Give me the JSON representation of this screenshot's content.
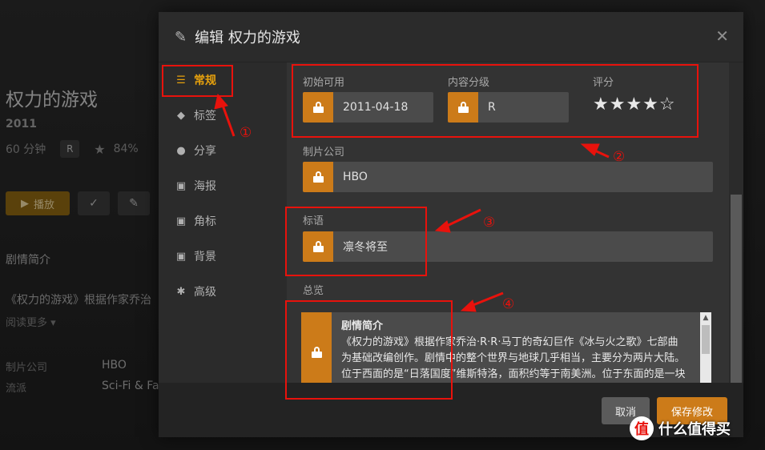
{
  "background": {
    "title": "权力的游戏",
    "year": "2011",
    "duration": "60 分钟",
    "rating_badge": "R",
    "score": "84%",
    "play_label": "播放",
    "summary_heading": "剧情简介",
    "summary_text": "《权力的游戏》根据作家乔治",
    "read_more": "阅读更多 ▾",
    "studio_label": "制片公司",
    "studio_value": "HBO",
    "genre_label": "流派",
    "genre_value": "Sci-Fi & Fa"
  },
  "modal": {
    "title": "编辑 权力的游戏",
    "sidebar": [
      {
        "label": "常规",
        "icon": "list-icon",
        "active": true
      },
      {
        "label": "标签",
        "icon": "tag-icon",
        "active": false
      },
      {
        "label": "分享",
        "icon": "users-icon",
        "active": false
      },
      {
        "label": "海报",
        "icon": "image-icon",
        "active": false
      },
      {
        "label": "角标",
        "icon": "image-icon",
        "active": false
      },
      {
        "label": "背景",
        "icon": "image-icon",
        "active": false
      },
      {
        "label": "高级",
        "icon": "gear-icon",
        "active": false
      }
    ],
    "fields": {
      "originally_available_label": "初始可用",
      "originally_available_value": "2011-04-18",
      "content_rating_label": "内容分级",
      "content_rating_value": "R",
      "rating_label": "评分",
      "rating_stars": "★★★★☆",
      "studio_label": "制片公司",
      "studio_value": "HBO",
      "tagline_label": "标语",
      "tagline_value": "凛冬将至",
      "summary_label": "总览",
      "summary_heading": "剧情简介",
      "summary_text": "《权力的游戏》根据作家乔治·R·R·马丁的奇幻巨作《冰与火之歌》七部曲为基础改编创作。剧情中的整个世界与地球几乎相当，主要分为两片大陆。位于西面的是“日落国度”维斯特洛，面积约等于南美洲。位于东面的是一块面积、形状近似于亚欧大陆的陆地"
    },
    "cancel_label": "取消",
    "save_label": "保存修改"
  },
  "annotations": [
    "①",
    "②",
    "③",
    "④"
  ],
  "watermark": "什么值得买",
  "colors": {
    "accent": "#e5a00d",
    "lock": "#cc7b19",
    "annotation": "#e8120c"
  }
}
